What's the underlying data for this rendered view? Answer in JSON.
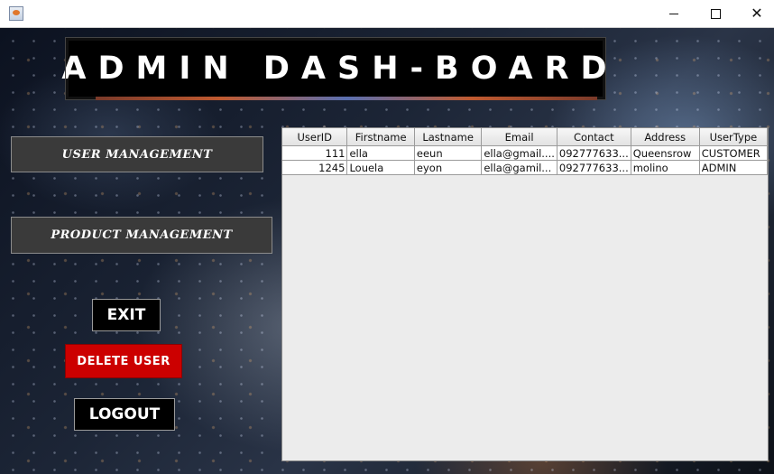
{
  "window": {
    "app_icon": "java-app-icon",
    "controls": [
      "minimize-icon",
      "maximize-icon",
      "close-icon"
    ],
    "close_glyph": "✕"
  },
  "header": {
    "title": "ADMIN DASH-BOARD"
  },
  "nav": {
    "user_management": "USER MANAGEMENT",
    "product_management": "PRODUCT MANAGEMENT"
  },
  "actions": {
    "exit": "EXIT",
    "delete_user": "DELETE USER",
    "logout": "LOGOUT"
  },
  "colors": {
    "delete_button": "#cc0000",
    "nav_button": "#3a3a3a",
    "banner": "#000000"
  },
  "table": {
    "columns": [
      "UserID",
      "Firstname",
      "Lastname",
      "Email",
      "Contact",
      "Address",
      "UserType"
    ],
    "rows": [
      [
        "111",
        "ella",
        "eeun",
        "ella@gmail....",
        "092777633...",
        "Queensrow",
        "CUSTOMER"
      ],
      [
        "1245",
        "Louela",
        "eyon",
        "ella@gamil...",
        "092777633...",
        "molino",
        "ADMIN"
      ]
    ]
  }
}
